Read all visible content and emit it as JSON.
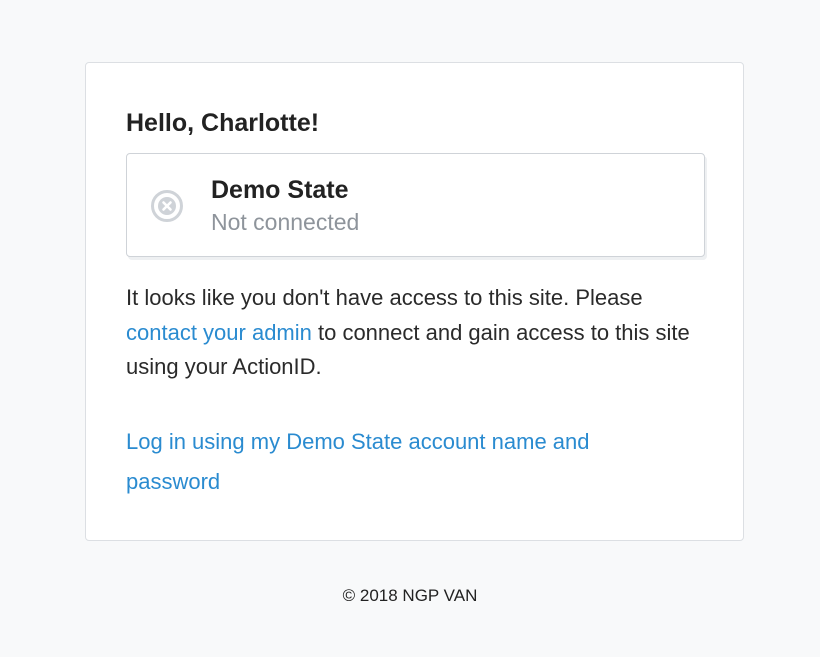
{
  "card": {
    "greeting": "Hello, Charlotte!",
    "site": {
      "name": "Demo State",
      "status": "Not connected",
      "status_icon": "x-circle-icon",
      "status_icon_color": "#cfd3d8"
    },
    "message": {
      "part1": "It looks like you don't have access to this site. Please ",
      "link_label": "contact your admin",
      "part2": " to connect and gain access to this site using your ActionID."
    },
    "login_link_label": "Log in using my Demo State account name and password"
  },
  "footer": {
    "copyright": "© 2018 NGP VAN"
  },
  "colors": {
    "background": "#f8f9fa",
    "card": "#ffffff",
    "link": "#2a8bd0",
    "muted_text": "#8e949b",
    "text": "#2a2a2a"
  }
}
